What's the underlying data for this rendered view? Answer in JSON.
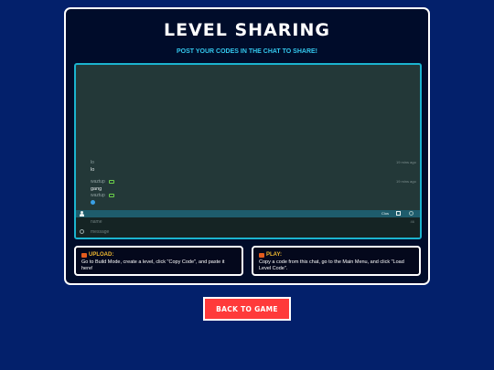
{
  "header": {
    "title": "LEVEL SHARING",
    "subtitle": "POST YOUR CODES IN THE CHAT TO SHARE!"
  },
  "chat": {
    "messages": [
      {
        "user": "lo",
        "text": "lo",
        "time": "19 mins ago"
      },
      {
        "user": "waztup",
        "text": "gang",
        "time": "19 mins ago"
      },
      {
        "user": "waztup",
        "text": "",
        "time": ""
      }
    ],
    "toolbar": {
      "close_label": "Clos"
    },
    "name_placeholder": "name",
    "message_placeholder": "message",
    "name_counter": "46"
  },
  "instructions": {
    "upload": {
      "title": "UPLOAD:",
      "body": "Go to Build Mode, create a level, click \"Copy Code\", and paste it here!"
    },
    "play": {
      "title": "PLAY:",
      "body": "Copy a code from this chat, go to the Main Menu, and click \"Load Level Code\"."
    }
  },
  "footer": {
    "back_label": "BACK TO GAME"
  },
  "colors": {
    "accent": "#1bb4cf",
    "button": "#ff3a3a",
    "background": "#03206b"
  }
}
